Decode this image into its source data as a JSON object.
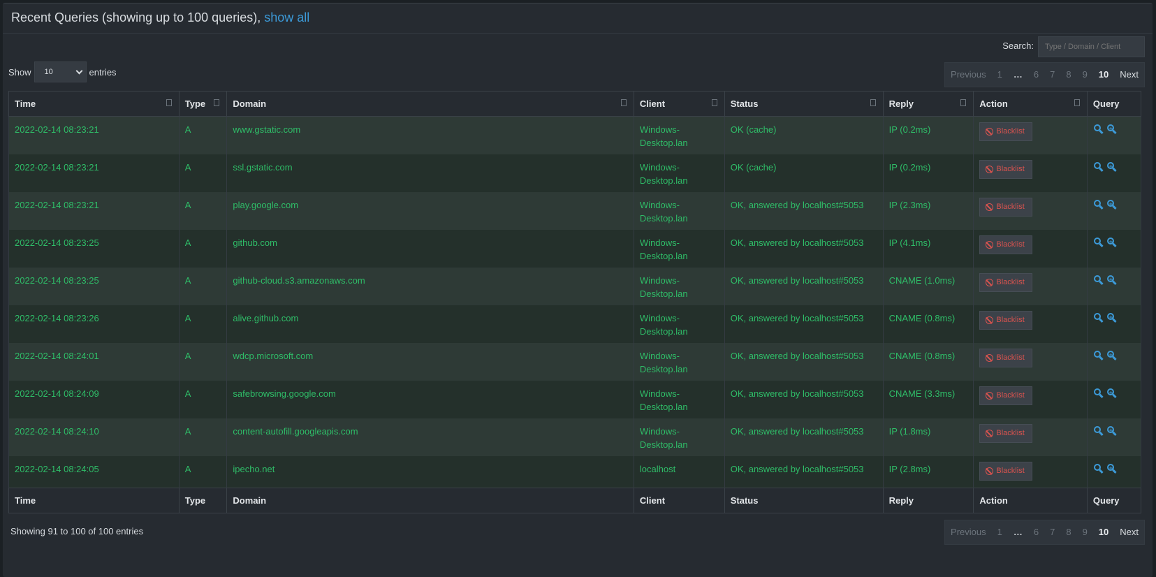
{
  "header": {
    "title": "Recent Queries (showing up to 100 queries), ",
    "show_all": "show all"
  },
  "search": {
    "label": "Search:",
    "placeholder": "Type / Domain / Client"
  },
  "length": {
    "show": "Show",
    "value": "10",
    "entries": "entries"
  },
  "pagination": {
    "previous": "Previous",
    "pages": [
      "1",
      "…",
      "6",
      "7",
      "8",
      "9",
      "10"
    ],
    "active": "10",
    "next": "Next"
  },
  "columns": [
    "Time",
    "Type",
    "Domain",
    "Client",
    "Status",
    "Reply",
    "Action",
    "Query"
  ],
  "rows": [
    {
      "time": "2022-02-14 08:23:21",
      "type": "A",
      "domain": "www.gstatic.com",
      "client": "Windows-Desktop.lan",
      "status": "OK (cache)",
      "reply": "IP (0.2ms)"
    },
    {
      "time": "2022-02-14 08:23:21",
      "type": "A",
      "domain": "ssl.gstatic.com",
      "client": "Windows-Desktop.lan",
      "status": "OK (cache)",
      "reply": "IP (0.2ms)"
    },
    {
      "time": "2022-02-14 08:23:21",
      "type": "A",
      "domain": "play.google.com",
      "client": "Windows-Desktop.lan",
      "status": "OK, answered by localhost#5053",
      "reply": "IP (2.3ms)"
    },
    {
      "time": "2022-02-14 08:23:25",
      "type": "A",
      "domain": "github.com",
      "client": "Windows-Desktop.lan",
      "status": "OK, answered by localhost#5053",
      "reply": "IP (4.1ms)"
    },
    {
      "time": "2022-02-14 08:23:25",
      "type": "A",
      "domain": "github-cloud.s3.amazonaws.com",
      "client": "Windows-Desktop.lan",
      "status": "OK, answered by localhost#5053",
      "reply": "CNAME (1.0ms)"
    },
    {
      "time": "2022-02-14 08:23:26",
      "type": "A",
      "domain": "alive.github.com",
      "client": "Windows-Desktop.lan",
      "status": "OK, answered by localhost#5053",
      "reply": "CNAME (0.8ms)"
    },
    {
      "time": "2022-02-14 08:24:01",
      "type": "A",
      "domain": "wdcp.microsoft.com",
      "client": "Windows-Desktop.lan",
      "status": "OK, answered by localhost#5053",
      "reply": "CNAME (0.8ms)"
    },
    {
      "time": "2022-02-14 08:24:09",
      "type": "A",
      "domain": "safebrowsing.google.com",
      "client": "Windows-Desktop.lan",
      "status": "OK, answered by localhost#5053",
      "reply": "CNAME (3.3ms)"
    },
    {
      "time": "2022-02-14 08:24:10",
      "type": "A",
      "domain": "content-autofill.googleapis.com",
      "client": "Windows-Desktop.lan",
      "status": "OK, answered by localhost#5053",
      "reply": "IP (1.8ms)"
    },
    {
      "time": "2022-02-14 08:24:05",
      "type": "A",
      "domain": "ipecho.net",
      "client": "localhost",
      "status": "OK, answered by localhost#5053",
      "reply": "IP (2.8ms)"
    }
  ],
  "action_label": "Blacklist",
  "info": "Showing 91 to 100 of 100 entries",
  "colors": {
    "ok_text": "#2fbd68",
    "link": "#3c9ad8",
    "danger": "#d9534f"
  }
}
